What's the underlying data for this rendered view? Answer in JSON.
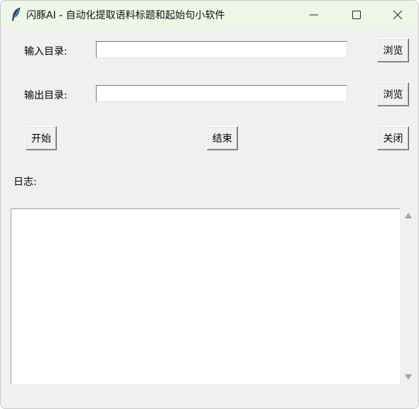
{
  "window": {
    "title": "闪豚AI - 自动化提取语料标题和起始句小软件",
    "icon": "feather-icon",
    "controls": [
      "minimize-icon",
      "maximize-icon",
      "close-icon"
    ]
  },
  "input_dir": {
    "label": "输入目录:",
    "value": "",
    "browse_label": "浏览"
  },
  "output_dir": {
    "label": "输出目录:",
    "value": "",
    "browse_label": "浏览"
  },
  "actions": {
    "start_label": "开始",
    "end_label": "结束",
    "close_label": "关闭"
  },
  "log": {
    "label": "日志:",
    "content": ""
  },
  "colors": {
    "titlebar": "#eef6e8",
    "window_bg": "#f0f0f0",
    "field_bg": "#ffffff"
  }
}
